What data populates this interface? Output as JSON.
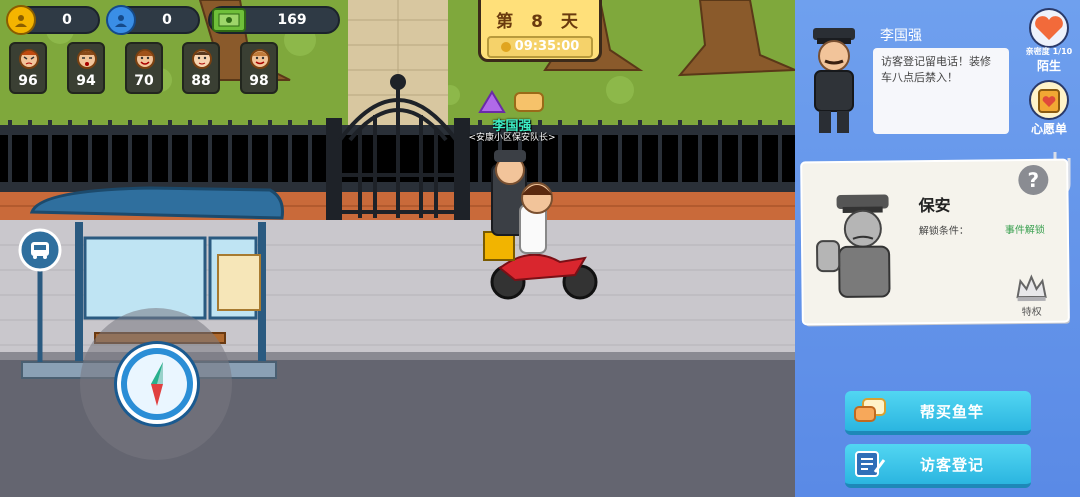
{
  "hud": {
    "gold": "0",
    "diamond": "0",
    "cash": "169",
    "residents": [
      {
        "value": "96",
        "icon": "resident-angry-icon"
      },
      {
        "value": "94",
        "icon": "resident-tired-icon"
      },
      {
        "value": "70",
        "icon": "resident-happy-icon"
      },
      {
        "value": "88",
        "icon": "resident-neutral-icon"
      },
      {
        "value": "98",
        "icon": "resident-smile-icon"
      }
    ]
  },
  "day": {
    "label": "第 8 天",
    "time": "09:35:00"
  },
  "npc": {
    "name": "李国强",
    "title": "<安康小区保安队长>"
  },
  "panel": {
    "npc_name": "李国强",
    "speech": "访客登记留电话！装修车八点后禁入！",
    "affinity_label": "亲密度 1/10",
    "affinity_status": "陌生",
    "wishlist_label": "心愿单",
    "role_card": {
      "role": "保安",
      "condition_label": "解锁条件：",
      "condition_value": "事件解锁",
      "privilege_label": "特权"
    },
    "actions": [
      {
        "label": "帮买鱼竿",
        "icon": "chat-bubbles-icon"
      },
      {
        "label": "访客登记",
        "icon": "register-form-icon"
      }
    ]
  },
  "colors": {
    "panel_bg": "#5a8ae6",
    "button": "#2bb5e0",
    "name_teal": "#3df0c8",
    "day_card": "#ffe07a"
  }
}
